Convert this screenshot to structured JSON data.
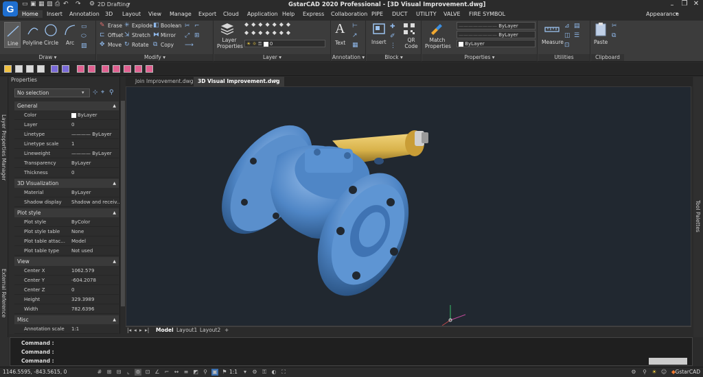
{
  "app": {
    "logo_letter": "G",
    "workspace": "2D Drafting",
    "title": "GstarCAD 2020 Professional - [3D Visual Improvement.dwg]",
    "appearance": "Appearance"
  },
  "tabs": [
    "Home",
    "Insert",
    "Annotation",
    "3D",
    "Layout",
    "View",
    "Manage",
    "Export",
    "Cloud",
    "Application",
    "Help",
    "Express",
    "Collaboration",
    "PIPE",
    "DUCT",
    "UTILITY",
    "VALVE",
    "FIRE SYMBOL"
  ],
  "ribbon": {
    "draw": {
      "title": "Draw",
      "line": "Line",
      "polyline": "Polyline",
      "circle": "Circle",
      "arc": "Arc"
    },
    "modify": {
      "title": "Modify",
      "erase": "Erase",
      "explode": "Explode",
      "boolean": "Boolean",
      "offset": "Offset",
      "stretch": "Stretch",
      "mirror": "Mirror",
      "move": "Move",
      "rotate": "Rotate",
      "copy": "Copy"
    },
    "layer": {
      "title": "Layer",
      "layer_properties": "Layer Properties",
      "current_layer": "0"
    },
    "annotation": {
      "title": "Annotation",
      "text": "Text"
    },
    "block": {
      "title": "Block",
      "insert": "Insert",
      "qr_code": "QR Code"
    },
    "properties": {
      "title": "Properties",
      "match": "Match Properties",
      "color": "ByLayer",
      "linetype": "ByLayer",
      "lineweight": "ByLayer",
      "layer_val": "ByLayer"
    },
    "utilities": {
      "title": "Utilities",
      "measure": "Measure"
    },
    "clipboard": {
      "title": "Clipboard",
      "paste": "Paste"
    }
  },
  "side": {
    "layer_manager": "Layer Properties Manager",
    "external_reference": "External Reference",
    "tool_palettes": "Tool Palettes"
  },
  "properties": {
    "header": "Properties",
    "selection": "No selection",
    "general": {
      "title": "General",
      "rows": [
        {
          "k": "Color",
          "v": "ByLayer"
        },
        {
          "k": "Layer",
          "v": "0"
        },
        {
          "k": "Linetype",
          "v": "———— ByLayer"
        },
        {
          "k": "Linetype scale",
          "v": "1"
        },
        {
          "k": "Lineweight",
          "v": "———— ByLayer"
        },
        {
          "k": "Transparency",
          "v": "ByLayer"
        },
        {
          "k": "Thickness",
          "v": "0"
        }
      ]
    },
    "viz": {
      "title": "3D Visualization",
      "rows": [
        {
          "k": "Material",
          "v": "ByLayer"
        },
        {
          "k": "Shadow display",
          "v": "Shadow and receiv..."
        }
      ]
    },
    "plot": {
      "title": "Plot style",
      "rows": [
        {
          "k": "Plot style",
          "v": "ByColor"
        },
        {
          "k": "Plot style table",
          "v": "None"
        },
        {
          "k": "Plot table attac...",
          "v": "Model"
        },
        {
          "k": "Plot table type",
          "v": "Not used"
        }
      ]
    },
    "view": {
      "title": "View",
      "rows": [
        {
          "k": "Center X",
          "v": "1062.579"
        },
        {
          "k": "Center Y",
          "v": "-604.2078"
        },
        {
          "k": "Center Z",
          "v": "0"
        },
        {
          "k": "Height",
          "v": "329.3989"
        },
        {
          "k": "Width",
          "v": "782.6396"
        }
      ]
    },
    "misc": {
      "title": "Misc",
      "rows": [
        {
          "k": "Annotation scale",
          "v": "1:1"
        }
      ]
    }
  },
  "doctabs": [
    "Join Improvement.dwg",
    "3D Visual Improvement.dwg"
  ],
  "layouts": [
    "Model",
    "Layout1",
    "Layout2"
  ],
  "command": [
    "Command :",
    "Command :",
    "Command :"
  ],
  "status": {
    "coords": "1146.5595, -843.5615, 0",
    "scale": "1:1",
    "brand": "GstarCAD"
  },
  "colors": {
    "valve_body": "#4f86c6",
    "actuator": "#d8b24a",
    "viewport_bg": "#212830"
  }
}
